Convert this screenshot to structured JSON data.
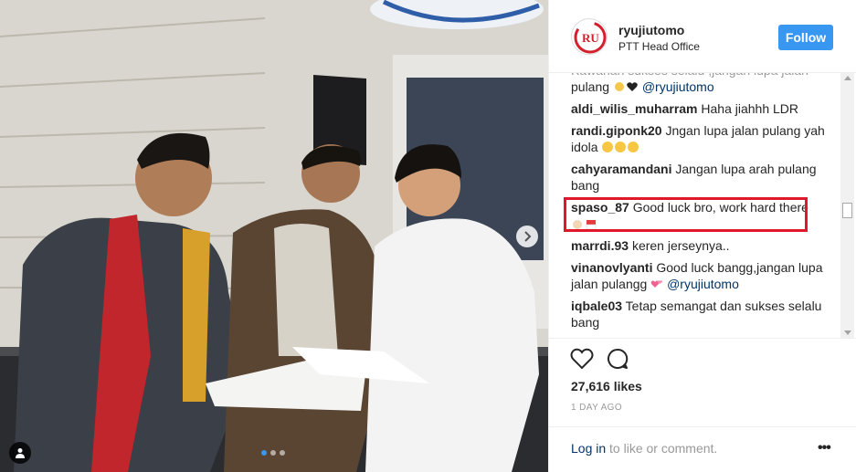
{
  "post": {
    "username": "ryujiutomo",
    "location": "PTT Head Office",
    "follow_label": "Follow",
    "likes": "27,616 likes",
    "time": "1 DAY AGO"
  },
  "comments": [
    {
      "user": "",
      "text": "pulang",
      "emoji": "sun,heart",
      "mention": "@ryujiutomo",
      "partial_top": "ke..."
    },
    {
      "user": "aldi_wilis_muharram",
      "text": "Haha jiahhh LDR"
    },
    {
      "user": "randi.giponk20",
      "text": "Jngan lupa jalan pulang yah idola",
      "emoji": "laugh,laugh,laugh"
    },
    {
      "user": "cahyaramandani",
      "text": "Jangan lupa arah pulang bang"
    },
    {
      "user": "spaso_87",
      "text": "Good luck bro, work hard there",
      "emoji": "hands,flag"
    },
    {
      "user": "marrdi.93",
      "text": "keren jerseynya.."
    },
    {
      "user": "vinanovlyanti",
      "text": "Good luck bangg,jangan lupa jalan pulangg",
      "emoji": "hearts",
      "mention": "@ryujiutomo"
    },
    {
      "user": "iqbale03",
      "text": "Tetap semangat dan sukses selalu bang"
    }
  ],
  "footer": {
    "login_link": "Log in",
    "login_rest": "to like or comment.",
    "more": "•••"
  },
  "colors": {
    "accent": "#3897f0",
    "highlight": "#e0182a",
    "mention": "#003569"
  },
  "icons": [
    "heart-outline-icon",
    "comment-bubble-icon",
    "chevron-right-icon",
    "person-tag-icon",
    "more-dots-icon"
  ]
}
